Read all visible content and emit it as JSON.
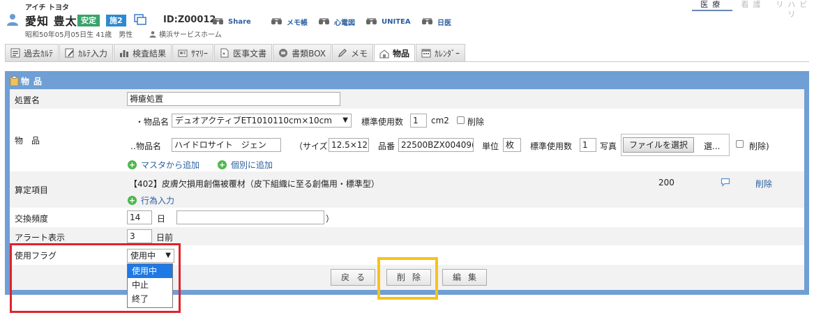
{
  "header": {
    "kana": "アイチ トヨタ",
    "name": "愛知 豊太",
    "badge_stable": "安定",
    "badge_facility": "施2",
    "patient_id": "ID:Z00012",
    "links": [
      "Share",
      "メモ帳",
      "心電図",
      "UNITEA",
      "日医"
    ],
    "birth_info": "昭和50年05月05日生 41歳　男性",
    "facility": "横浜サービスホーム"
  },
  "right_tabs": [
    "医療",
    "看護",
    "リハビリ"
  ],
  "tabs": [
    "過去ｶﾙﾃ",
    "ｶﾙﾃ入力",
    "検査結果",
    "ｻﾏﾘｰ",
    "医事文書",
    "書類BOX",
    "メモ",
    "物品",
    "ｶﾚﾝﾀﾞｰ"
  ],
  "active_tab": "物品",
  "panel": {
    "title": "物品",
    "treatment": {
      "label": "処置名",
      "value": "褥瘡処置"
    },
    "items": {
      "label": "物　品",
      "item1": {
        "prefix": "・物品名",
        "name": "デュオアクティブET1010110cm×10cm",
        "std_label": "標準使用数",
        "std_value": "1",
        "unit": "cm2",
        "delete": "削除"
      },
      "item2": {
        "prefix": "‥物品名",
        "name": "ハイドロサイト　ジェン",
        "size_label": "（サイズ",
        "size_value": "12.5×12.",
        "code_label": "品番",
        "code_value": "22500BZX00409(",
        "unit_label": "単位",
        "unit_value": "枚",
        "std_label": "標準使用数",
        "std_value": "1",
        "photo_label": "写真",
        "file_button": "ファイルを選択",
        "file_status": "選...",
        "delete": "削除)"
      },
      "add_master": "マスタから追加",
      "add_individual": "個別に追加"
    },
    "calc": {
      "label": "算定項目",
      "item": "【402】皮膚欠損用創傷被覆材（皮下組織に至る創傷用・標準型）",
      "points": "200",
      "delete": "削除",
      "add_action": "行為入力"
    },
    "exchange": {
      "label": "交換頻度",
      "value": "14",
      "unit": "日",
      "paren_open": "（",
      "paren_close": "）",
      "note": ""
    },
    "alert": {
      "label": "アラート表示",
      "value": "3",
      "unit": "日前"
    },
    "flag": {
      "label": "使用フラグ",
      "selected": "使用中",
      "options": [
        "使用中",
        "中止",
        "終了"
      ]
    }
  },
  "buttons": {
    "back": "戻る",
    "delete": "削除",
    "edit": "編集"
  },
  "colors": {
    "panel": "#6f9fd4",
    "highlight_red": "#e0222a",
    "highlight_yellow": "#f7c21a",
    "dropdown_selected": "#1e79e4"
  }
}
